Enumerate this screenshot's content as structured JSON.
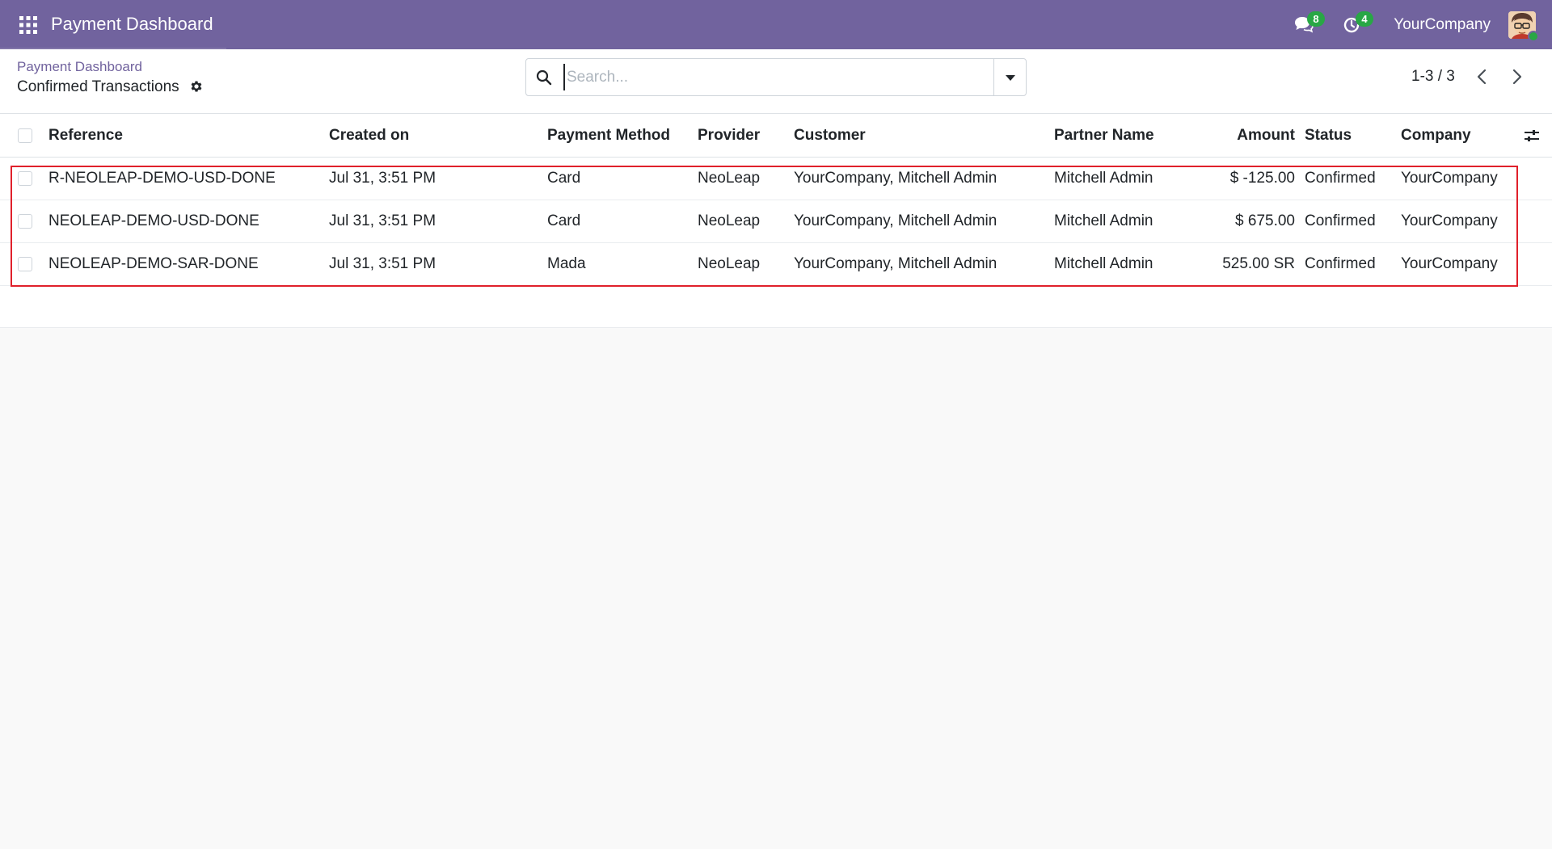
{
  "navbar": {
    "app_title": "Payment Dashboard",
    "apps_icon": "grid-icon",
    "messages_badge": "8",
    "activities_badge": "4",
    "company": "YourCompany",
    "colors": {
      "navbar_bg": "#71639e",
      "badge": "#28a745"
    }
  },
  "control_panel": {
    "breadcrumb_parent": "Payment Dashboard",
    "breadcrumb_current": "Confirmed Transactions",
    "search_placeholder": "Search...",
    "pager": "1-3 / 3"
  },
  "table": {
    "headers": {
      "reference": "Reference",
      "created_on": "Created on",
      "payment_method": "Payment Method",
      "provider": "Provider",
      "customer": "Customer",
      "partner_name": "Partner Name",
      "amount": "Amount",
      "status": "Status",
      "company": "Company"
    },
    "rows": [
      {
        "reference": "R-NEOLEAP-DEMO-USD-DONE",
        "created_on": "Jul 31, 3:51 PM",
        "payment_method": "Card",
        "provider": "NeoLeap",
        "customer": "YourCompany, Mitchell Admin",
        "partner_name": "Mitchell Admin",
        "amount": "$ -125.00",
        "status": "Confirmed",
        "company": "YourCompany"
      },
      {
        "reference": "NEOLEAP-DEMO-USD-DONE",
        "created_on": "Jul 31, 3:51 PM",
        "payment_method": "Card",
        "provider": "NeoLeap",
        "customer": "YourCompany, Mitchell Admin",
        "partner_name": "Mitchell Admin",
        "amount": "$ 675.00",
        "status": "Confirmed",
        "company": "YourCompany"
      },
      {
        "reference": "NEOLEAP-DEMO-SAR-DONE",
        "created_on": "Jul 31, 3:51 PM",
        "payment_method": "Mada",
        "provider": "NeoLeap",
        "customer": "YourCompany, Mitchell Admin",
        "partner_name": "Mitchell Admin",
        "amount": "525.00 SR",
        "status": "Confirmed",
        "company": "YourCompany"
      }
    ]
  }
}
